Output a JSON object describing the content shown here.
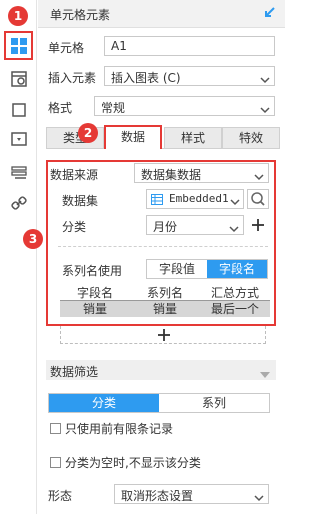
{
  "header": {
    "title": "单元格元素"
  },
  "cell": {
    "label": "单元格",
    "value": "A1"
  },
  "insert": {
    "label": "插入元素",
    "value": "插入图表 (C)"
  },
  "format": {
    "label": "格式",
    "value": "常规"
  },
  "tabs": [
    {
      "label": "类型"
    },
    {
      "label": "数据"
    },
    {
      "label": "样式"
    },
    {
      "label": "特效"
    }
  ],
  "data_source": {
    "label": "数据来源",
    "value": "数据集数据"
  },
  "dataset": {
    "label": "数据集",
    "value": "Embedded1"
  },
  "category": {
    "label": "分类",
    "value": "月份"
  },
  "series_name": {
    "label": "系列名使用",
    "options": [
      "字段值",
      "字段名"
    ],
    "selected": "字段名"
  },
  "table": {
    "headers": [
      "字段名",
      "系列名",
      "汇总方式"
    ],
    "rows": [
      [
        "销量",
        "销量",
        "最后一个"
      ]
    ]
  },
  "filter": {
    "title": "数据筛选",
    "tabs": [
      "分类",
      "系列"
    ],
    "selected": "分类",
    "checkbox1": "只使用前有限条记录",
    "checkbox2": "分类为空时,不显示该分类"
  },
  "shape": {
    "label": "形态",
    "value": "取消形态设置"
  },
  "badges": [
    "1",
    "2",
    "3"
  ],
  "colors": {
    "accent": "#2e9bf0",
    "highlight": "#e53935"
  }
}
